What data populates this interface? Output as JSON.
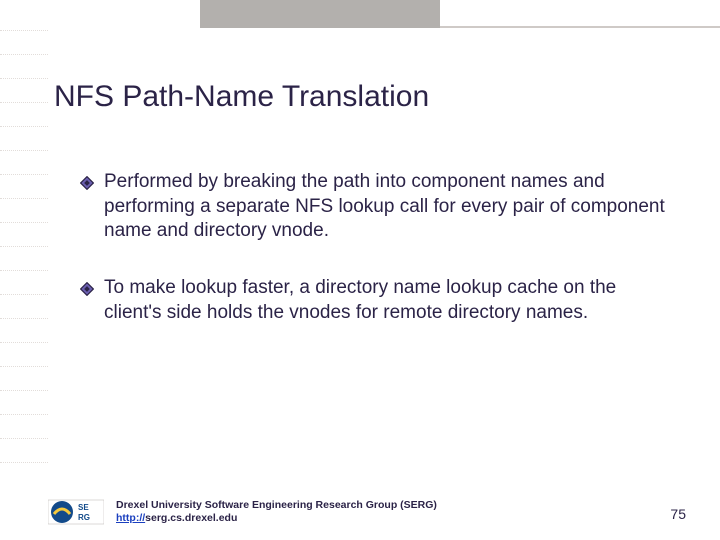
{
  "title": "NFS Path-Name Translation",
  "bullets": [
    "Performed by breaking the path into component names and performing a separate NFS lookup call for every pair of component name and directory vnode.",
    "To make lookup faster, a directory name lookup cache on the client's side holds the vnodes for remote directory names."
  ],
  "footer": {
    "org": "Drexel University Software Engineering Research Group (SERG)",
    "url_label": "http://",
    "url_rest": "serg.cs.drexel.edu"
  },
  "slide_number": "75",
  "colors": {
    "accent": "#2b2347",
    "bullet_fill": "#5a4ea0",
    "bullet_stroke": "#2b2347"
  }
}
